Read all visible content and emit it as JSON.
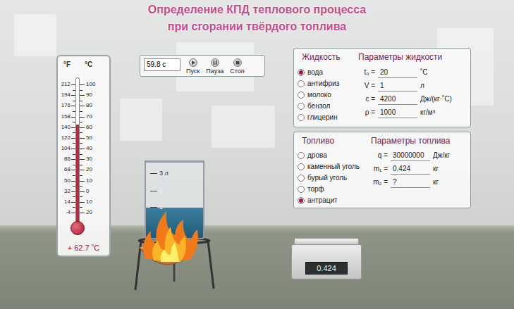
{
  "title": [
    "Определение КПД теплового процесса",
    "при сгорании твёрдого топлива"
  ],
  "thermometer": {
    "unit_f": "°F",
    "unit_c": "°C",
    "scale_f": [
      "212",
      "194",
      "176",
      "158",
      "140",
      "122",
      "104",
      "86",
      "68",
      "50",
      "32",
      "14",
      "-4"
    ],
    "scale_c": [
      "100",
      "90",
      "80",
      "70",
      "60",
      "50",
      "40",
      "30",
      "20",
      "10",
      "0",
      "10",
      "20"
    ],
    "level": 0.689,
    "reading": "+ 62.7 ˚C"
  },
  "timer": {
    "value": "59.8 с",
    "buttons": [
      {
        "label": "Пуск",
        "kind": "play"
      },
      {
        "label": "Пауза",
        "kind": "pause"
      },
      {
        "label": "Стоп",
        "kind": "stop"
      }
    ]
  },
  "liquid": {
    "header": "Жидкость",
    "params_header": "Параметры жидкости",
    "options": [
      {
        "label": "вода",
        "selected": true
      },
      {
        "label": "антифриз",
        "selected": false
      },
      {
        "label": "молоко",
        "selected": false
      },
      {
        "label": "бензол",
        "selected": false
      },
      {
        "label": "глицерин",
        "selected": false
      }
    ],
    "params": [
      {
        "label": "t₀ =",
        "value": "20",
        "unit": "˚C"
      },
      {
        "label": "V =",
        "value": "1",
        "unit": "л"
      },
      {
        "label": "c =",
        "value": "4200",
        "unit": "Дж/(кг·˚C)"
      },
      {
        "label": "ρ =",
        "value": "1000",
        "unit": "кг/м³"
      }
    ]
  },
  "fuel": {
    "header": "Топливо",
    "params_header": "Параметры топлива",
    "options": [
      {
        "label": "дрова",
        "selected": false
      },
      {
        "label": "каменный уголь",
        "selected": false
      },
      {
        "label": "бурый уголь",
        "selected": false
      },
      {
        "label": "торф",
        "selected": false
      },
      {
        "label": "антрацит",
        "selected": true
      }
    ],
    "params": [
      {
        "label": "q =",
        "value": "30000000",
        "unit": "Дж/кг"
      },
      {
        "label": "m₁ =",
        "value": "0.424",
        "unit": "кг"
      },
      {
        "label": "m₂ =",
        "value": "?",
        "unit": "кг"
      }
    ]
  },
  "beaker": {
    "marks": [
      "3 л",
      "2",
      "1"
    ],
    "level": 0.4
  },
  "scale": {
    "display": "0.424"
  }
}
